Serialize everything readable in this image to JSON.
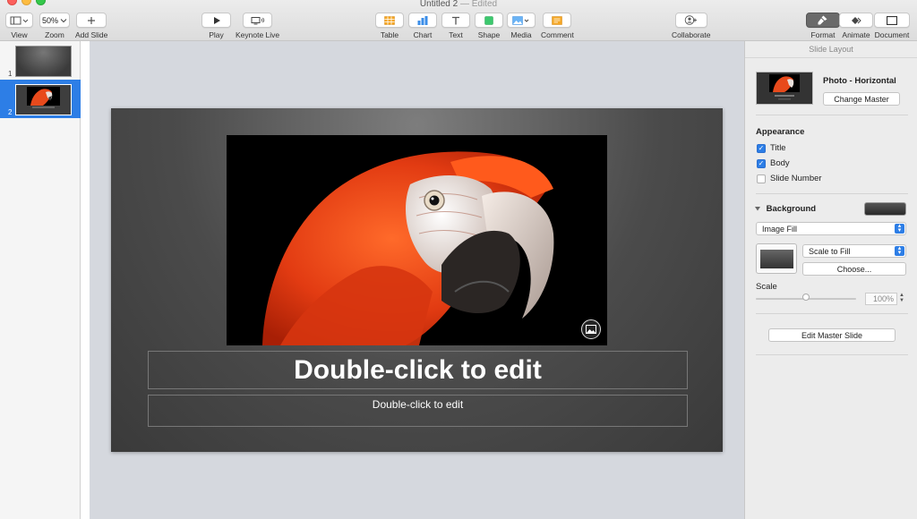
{
  "window": {
    "title": "Untitled 2",
    "edited": "— Edited"
  },
  "toolbar": {
    "view_label": "View",
    "zoom_value": "50%",
    "zoom_label": "Zoom",
    "add_slide_label": "Add Slide",
    "play_label": "Play",
    "keynote_live_label": "Keynote Live",
    "table_label": "Table",
    "chart_label": "Chart",
    "text_label": "Text",
    "shape_label": "Shape",
    "media_label": "Media",
    "comment_label": "Comment",
    "collaborate_label": "Collaborate",
    "format_label": "Format",
    "animate_label": "Animate",
    "document_label": "Document"
  },
  "navigator": {
    "slides": [
      {
        "number": "1"
      },
      {
        "number": "2"
      }
    ],
    "selected": 2
  },
  "slide": {
    "title_placeholder": "Double-click to edit",
    "body_placeholder": "Double-click to edit"
  },
  "inspector": {
    "header": "Slide Layout",
    "master_name": "Photo - Horizontal",
    "change_master_label": "Change Master",
    "appearance_title": "Appearance",
    "appearance_options": [
      {
        "label": "Title",
        "checked": true
      },
      {
        "label": "Body",
        "checked": true
      },
      {
        "label": "Slide Number",
        "checked": false
      }
    ],
    "background_title": "Background",
    "fill_type": "Image Fill",
    "scale_mode": "Scale to Fill",
    "choose_label": "Choose...",
    "scale_label": "Scale",
    "scale_value": "100%",
    "scale_level": 0.5,
    "edit_master_label": "Edit Master Slide"
  },
  "colors": {
    "accent": "#2d7ee6",
    "canvas": "#d5d8de",
    "slide_bg": "#4b4b4b"
  },
  "icons": [
    "view-icon",
    "chevron-down-icon",
    "plus-icon",
    "play-icon",
    "keynote-live-icon",
    "table-icon",
    "chart-icon",
    "text-icon",
    "shape-icon",
    "media-icon",
    "comment-icon",
    "collaborate-icon",
    "format-icon",
    "animate-icon",
    "document-icon",
    "image-placeholder-icon"
  ]
}
